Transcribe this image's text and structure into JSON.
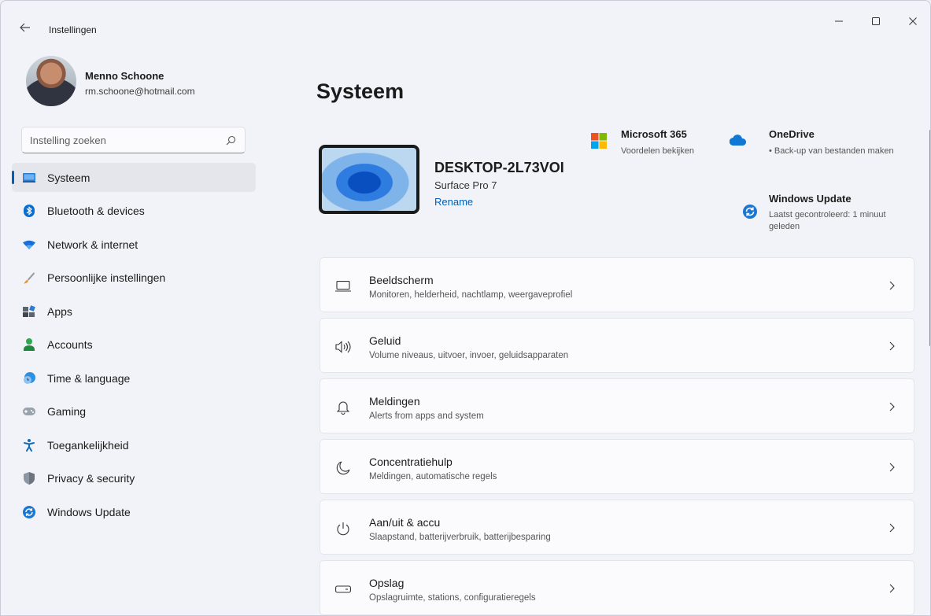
{
  "window": {
    "title": "Instellingen",
    "back_label": "←"
  },
  "profile": {
    "name": "Menno Schoone",
    "email": "rm.schoone@hotmail.com"
  },
  "search": {
    "placeholder": "Instelling zoeken"
  },
  "sidebar": {
    "items": [
      {
        "label": "Systeem",
        "icon": "monitor-icon",
        "active": true
      },
      {
        "label": "Bluetooth & devices",
        "icon": "bluetooth-icon"
      },
      {
        "label": "Network & internet",
        "icon": "wifi-icon"
      },
      {
        "label": "Persoonlijke instellingen",
        "icon": "brush-icon"
      },
      {
        "label": "Apps",
        "icon": "apps-icon"
      },
      {
        "label": "Accounts",
        "icon": "person-icon"
      },
      {
        "label": "Time & language",
        "icon": "clock-globe-icon"
      },
      {
        "label": "Gaming",
        "icon": "gamepad-icon"
      },
      {
        "label": "Toegankelijkheid",
        "icon": "accessibility-icon"
      },
      {
        "label": "Privacy & security",
        "icon": "shield-icon"
      },
      {
        "label": "Windows Update",
        "icon": "update-icon"
      }
    ]
  },
  "main": {
    "title": "Systeem",
    "device": {
      "name": "DESKTOP-2L73VOI",
      "model": "Surface Pro 7",
      "rename_label": "Rename"
    },
    "tiles": {
      "microsoft365": {
        "title": "Microsoft 365",
        "subtitle": "Voordelen bekijken"
      },
      "onedrive": {
        "title": "OneDrive",
        "subtitle": "• Back-up van bestanden maken"
      },
      "windows_update": {
        "title": "Windows Update",
        "subtitle": "Laatst gecontroleerd: 1 minuut geleden"
      }
    },
    "cards": [
      {
        "title": "Beeldscherm",
        "subtitle": "Monitoren, helderheid, nachtlamp, weergaveprofiel",
        "icon": "display-icon"
      },
      {
        "title": "Geluid",
        "subtitle": "Volume niveaus, uitvoer, invoer, geluidsapparaten",
        "icon": "speaker-icon"
      },
      {
        "title": "Meldingen",
        "subtitle": "Alerts from apps and system",
        "icon": "bell-icon"
      },
      {
        "title": "Concentratiehulp",
        "subtitle": "Meldingen, automatische regels",
        "icon": "moon-icon"
      },
      {
        "title": "Aan/uit & accu",
        "subtitle": "Slaapstand, batterijverbruik, batterijbesparing",
        "icon": "power-icon"
      },
      {
        "title": "Opslag",
        "subtitle": "Opslagruimte, stations, configuratieregels",
        "icon": "storage-icon"
      }
    ]
  }
}
